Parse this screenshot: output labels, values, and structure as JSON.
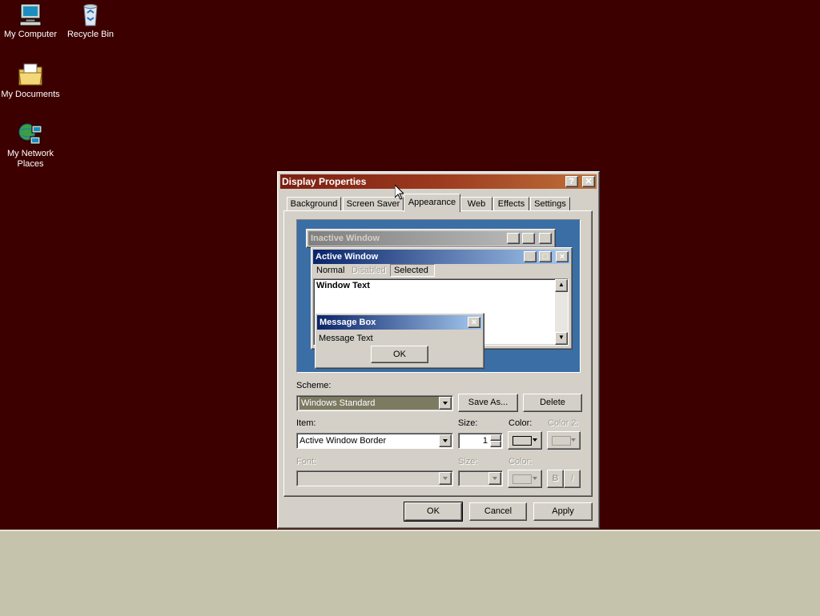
{
  "desktop": {
    "icons": [
      {
        "label": "My Computer"
      },
      {
        "label": "Recycle Bin"
      },
      {
        "label": "My Documents"
      },
      {
        "label": "My Network Places"
      }
    ]
  },
  "dialog": {
    "title": "Display Properties",
    "help_button": "?",
    "close_button": "✕",
    "tabs": [
      {
        "label": "Background"
      },
      {
        "label": "Screen Saver"
      },
      {
        "label": "Appearance"
      },
      {
        "label": "Web"
      },
      {
        "label": "Effects"
      },
      {
        "label": "Settings"
      }
    ],
    "active_tab": "Appearance",
    "preview": {
      "inactive_title": "Inactive Window",
      "active_title": "Active Window",
      "menu": [
        "Normal",
        "Disabled",
        "Selected"
      ],
      "window_text": "Window Text",
      "message_box_title": "Message Box",
      "message_text": "Message Text",
      "ok_label": "OK"
    },
    "scheme": {
      "label": "Scheme:",
      "value": "Windows Standard",
      "save_as": "Save As...",
      "delete": "Delete"
    },
    "item": {
      "label": "Item:",
      "value": "Active Window Border",
      "size_label": "Size:",
      "size_value": "1",
      "color_label": "Color:",
      "color2_label": "Color 2:"
    },
    "font": {
      "label": "Font:",
      "size_label": "Size:",
      "color_label": "Color:",
      "bold": "B",
      "italic": "I"
    },
    "buttons": {
      "ok": "OK",
      "cancel": "Cancel",
      "apply": "Apply"
    }
  },
  "colors": {
    "desktop": "#3d0000",
    "title_start": "#7b1f12",
    "title_end": "#c0703a",
    "preview_bg": "#3a6ea5",
    "active_title_start": "#0a246a",
    "active_title_end": "#a6caf0",
    "face": "#d4d0c8"
  }
}
